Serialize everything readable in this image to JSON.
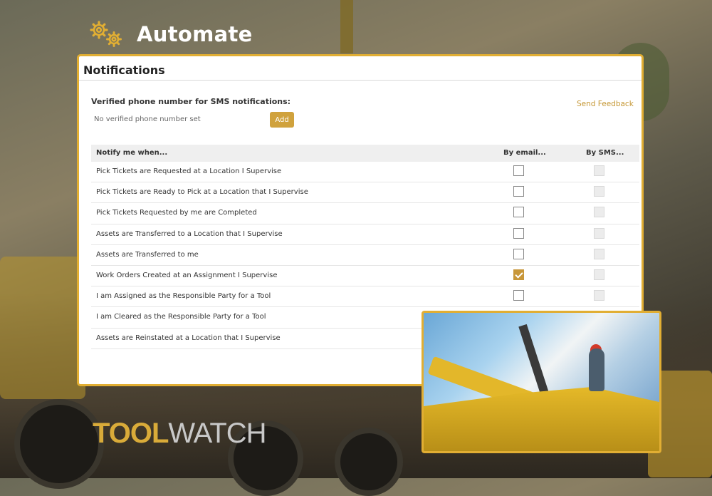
{
  "header": {
    "title": "Automate",
    "icon": "gears-icon",
    "accent": "#e1ae33"
  },
  "panel": {
    "title": "Notifications",
    "phone_label": "Verified phone number for SMS notifications:",
    "phone_value": "No verified phone number set",
    "add_label": "Add",
    "feedback_label": "Send Feedback"
  },
  "table": {
    "headers": [
      "Notify me when...",
      "By email...",
      "By SMS..."
    ],
    "rows": [
      {
        "label": "Pick Tickets are Requested at a Location I Supervise",
        "email": false,
        "sms": false
      },
      {
        "label": "Pick Tickets are Ready to Pick at a Location that I Supervise",
        "email": false,
        "sms": false
      },
      {
        "label": "Pick Tickets Requested by me are Completed",
        "email": false,
        "sms": false
      },
      {
        "label": "Assets are Transferred to a Location that I Supervise",
        "email": false,
        "sms": false
      },
      {
        "label": "Assets are Transferred to me",
        "email": false,
        "sms": false
      },
      {
        "label": "Work Orders Created at an Assignment I Supervise",
        "email": true,
        "sms": false
      },
      {
        "label": "I am Assigned as the Responsible Party for a Tool",
        "email": false,
        "sms": false
      },
      {
        "label": "I am Cleared as the Responsible Party for a Tool",
        "email": false,
        "sms": false
      },
      {
        "label": "Assets are Reinstated at a Location that I Supervise",
        "email": false,
        "sms": false
      }
    ]
  },
  "logo": {
    "part1": "TOOL",
    "part2": "WATCH"
  }
}
